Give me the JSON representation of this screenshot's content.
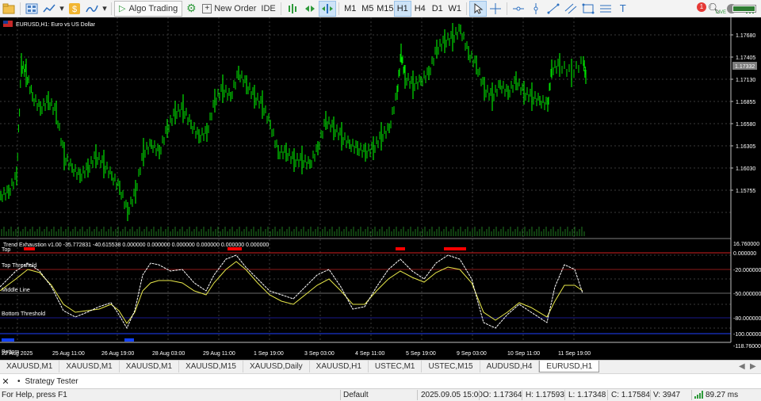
{
  "toolbar": {
    "algo_trading": "Algo Trading",
    "new_order": "New Order",
    "ide": "IDE",
    "timeframes": [
      "M1",
      "M5",
      "M15",
      "H1",
      "H4",
      "D1",
      "W1"
    ],
    "active_timeframe": "H1",
    "notification_count": "1",
    "connection_status": "LIVE",
    "battery_level": 0.92
  },
  "chart": {
    "header": "EURUSD,H1:  Euro vs US Dollar",
    "current_price": "1.17332",
    "price_ticks": [
      "1.17680",
      "1.17405",
      "1.17130",
      "1.16855",
      "1.16580",
      "1.16305",
      "1.16030",
      "1.15755"
    ],
    "time_ticks": [
      "22 Aug 2025",
      "25 Aug 11:00",
      "26 Aug 19:00",
      "28 Aug 03:00",
      "29 Aug 11:00",
      "1 Sep 19:00",
      "3 Sep 03:00",
      "4 Sep 11:00",
      "5 Sep 19:00",
      "9 Sep 03:00",
      "10 Sep 11:00",
      "11 Sep 19:00"
    ],
    "colors": {
      "candles": "#00e000",
      "indicator_line1": "#ffffff",
      "indicator_line2": "#e8e84a",
      "top_line": "#d02020",
      "bottom_line": "#2040ff"
    }
  },
  "indicator": {
    "header": "Trend Exhaustion v1.00 -35.772831 -40.615538 0.000000 0.000000 0.000000 0.000000 0.000000 0.000000",
    "scale": [
      "16.760000",
      "0.000000",
      "-20.000000",
      "-50.000000",
      "-80.000000",
      "-100.000000",
      "-118.760000"
    ],
    "levels": {
      "top": "Top",
      "top_threshold": "Top Threshold",
      "middle": "Middle Line",
      "bottom_threshold": "Bottom Threshold",
      "bottom": "Bottom"
    }
  },
  "tabs": [
    "XAUUSD,M1",
    "XAUUSD,M1",
    "XAUUSD,M1",
    "XAUUSD,M15",
    "XAUUSD,Daily",
    "XAUUSD,H1",
    "USTEC,M1",
    "USTEC,M15",
    "AUDUSD,H4",
    "EURUSD,H1"
  ],
  "active_tab": "EURUSD,H1",
  "strategy_tester": "Strategy Tester",
  "status": {
    "help": "For Help, press F1",
    "profile": "Default",
    "datetime": "2025.09.05 15:00",
    "open": "O: 1.17364",
    "high": "H: 1.17593",
    "low": "L: 1.17348",
    "close": "C: 1.17584",
    "volume": "V: 3947",
    "ping": "89.27 ms"
  }
}
